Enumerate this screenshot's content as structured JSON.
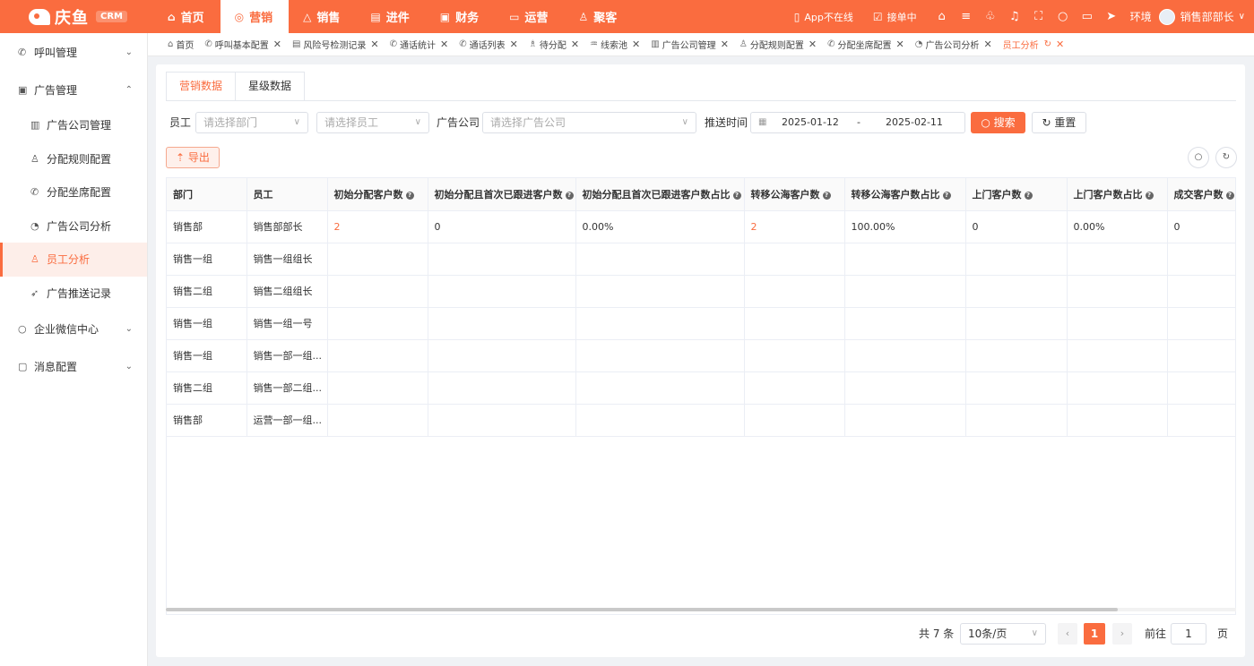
{
  "brand": {
    "logo_text": "庆鱼",
    "badge": "CRM"
  },
  "topnav": [
    {
      "label": "首页",
      "icon": "home-icon"
    },
    {
      "label": "营销",
      "icon": "marketing-icon",
      "active": true
    },
    {
      "label": "销售",
      "icon": "sales-icon"
    },
    {
      "label": "进件",
      "icon": "application-icon"
    },
    {
      "label": "财务",
      "icon": "finance-icon"
    },
    {
      "label": "运营",
      "icon": "operations-icon"
    },
    {
      "label": "聚客",
      "icon": "customers-icon"
    }
  ],
  "topright": {
    "app_status": "App不在线",
    "order_status": "接单中",
    "env": "环境",
    "user": "销售部部长"
  },
  "sidebar": {
    "groups": [
      {
        "label": "呼叫管理",
        "icon": "phone-icon",
        "chevron": "⌄"
      },
      {
        "label": "广告管理",
        "icon": "ad-icon",
        "chevron": "⌃"
      },
      {
        "label": "企业微信中心",
        "icon": "wechat-icon",
        "chevron": "⌄"
      },
      {
        "label": "消息配置",
        "icon": "message-icon",
        "chevron": "⌄"
      }
    ],
    "items": [
      {
        "label": "广告公司管理",
        "icon": "building-icon"
      },
      {
        "label": "分配规则配置",
        "icon": "user-rule-icon"
      },
      {
        "label": "分配坐席配置",
        "icon": "seat-icon"
      },
      {
        "label": "广告公司分析",
        "icon": "pie-icon"
      },
      {
        "label": "员工分析",
        "icon": "user-icon",
        "active": true
      },
      {
        "label": "广告推送记录",
        "icon": "send-icon"
      }
    ]
  },
  "tabs": [
    {
      "label": "首页"
    },
    {
      "label": "呼叫基本配置",
      "close": "✕"
    },
    {
      "label": "风险号检测记录",
      "close": "✕"
    },
    {
      "label": "通话统计",
      "close": "✕"
    },
    {
      "label": "通话列表",
      "close": "✕"
    },
    {
      "label": "待分配",
      "close": "✕"
    },
    {
      "label": "线索池",
      "close": "✕"
    },
    {
      "label": "广告公司管理",
      "close": "✕"
    },
    {
      "label": "分配规则配置",
      "close": "✕"
    },
    {
      "label": "分配坐席配置",
      "close": "✕"
    },
    {
      "label": "广告公司分析",
      "close": "✕"
    },
    {
      "label": "员工分析",
      "close": "✕",
      "active": true
    }
  ],
  "subtabs": [
    {
      "label": "营销数据",
      "active": true
    },
    {
      "label": "星级数据"
    }
  ],
  "filters": {
    "employee_label": "员工",
    "dept_placeholder": "请选择部门",
    "staff_placeholder": "请选择员工",
    "ad_company_label": "广告公司",
    "ad_company_placeholder": "请选择广告公司",
    "push_time_label": "推送时间",
    "date_start": "2025-01-12",
    "date_sep": "-",
    "date_end": "2025-02-11",
    "search_label": "搜索",
    "reset_label": "重置"
  },
  "export_label": "导出",
  "table": {
    "columns": [
      {
        "label": "部门",
        "help": false
      },
      {
        "label": "员工",
        "help": false
      },
      {
        "label": "初始分配客户数",
        "help": true
      },
      {
        "label": "初始分配且首次已跟进客户数",
        "help": true
      },
      {
        "label": "初始分配且首次已跟进客户数占比",
        "help": true
      },
      {
        "label": "转移公海客户数",
        "help": true
      },
      {
        "label": "转移公海客户数占比",
        "help": true
      },
      {
        "label": "上门客户数",
        "help": true
      },
      {
        "label": "上门客户数占比",
        "help": true
      },
      {
        "label": "成交客户数",
        "help": true
      }
    ],
    "rows": [
      [
        "销售部",
        "销售部部长",
        "2",
        "0",
        "0.00%",
        "2",
        "100.00%",
        "0",
        "0.00%",
        "0"
      ],
      [
        "销售一组",
        "销售一组组长",
        "",
        "",
        "",
        "",
        "",
        "",
        "",
        ""
      ],
      [
        "销售二组",
        "销售二组组长",
        "",
        "",
        "",
        "",
        "",
        "",
        "",
        ""
      ],
      [
        "销售一组",
        "销售一组一号",
        "",
        "",
        "",
        "",
        "",
        "",
        "",
        ""
      ],
      [
        "销售一组",
        "销售一部一组...",
        "",
        "",
        "",
        "",
        "",
        "",
        "",
        ""
      ],
      [
        "销售二组",
        "销售一部二组...",
        "",
        "",
        "",
        "",
        "",
        "",
        "",
        ""
      ],
      [
        "销售部",
        "运营一部一组...",
        "",
        "",
        "",
        "",
        "",
        "",
        "",
        ""
      ]
    ],
    "link_columns": [
      2,
      5
    ]
  },
  "pagination": {
    "total": "共 7 条",
    "page_size": "10条/页",
    "current": "1",
    "goto_label": "前往",
    "goto_value": "1",
    "page_suffix": "页"
  },
  "colors": {
    "accent": "#fa6c3f"
  }
}
